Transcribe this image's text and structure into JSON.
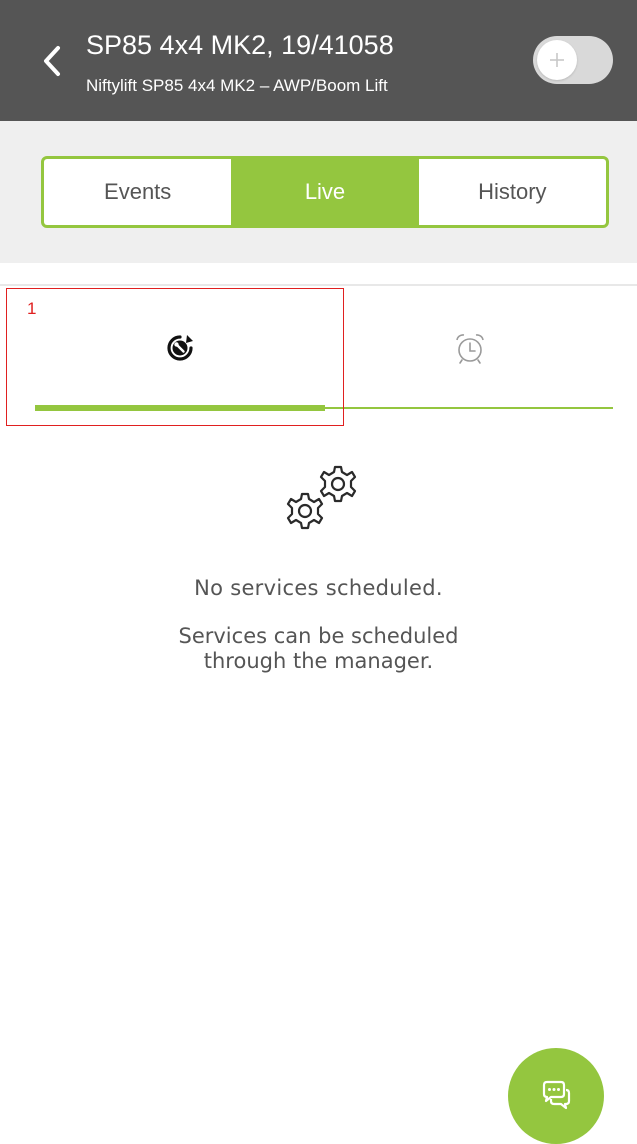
{
  "header": {
    "title": "SP85 4x4 MK2, 19/41058",
    "subtitle": "Niftylift SP85 4x4 MK2 – AWP/Boom Lift",
    "back_icon": "chevron-left-icon",
    "toggle_icon": "plus-icon"
  },
  "segments": {
    "items": [
      {
        "label": "Events"
      },
      {
        "label": "Live"
      },
      {
        "label": "History"
      }
    ],
    "selected": "Live"
  },
  "subtabs": {
    "items": [
      {
        "icon": "service-wrench-icon"
      },
      {
        "icon": "alarm-clock-icon"
      }
    ],
    "selected_index": 0
  },
  "annotation": {
    "label": "1"
  },
  "empty_state": {
    "icon": "gears-icon",
    "title": "No services scheduled.",
    "description_line1": "Services can be scheduled",
    "description_line2": "through the manager."
  },
  "fab": {
    "icon": "chat-bubbles-icon"
  },
  "colors": {
    "accent": "#94c63f",
    "header_bg": "#555555",
    "band_bg": "#efefef",
    "text": "#555555",
    "annotation": "#e02020"
  }
}
